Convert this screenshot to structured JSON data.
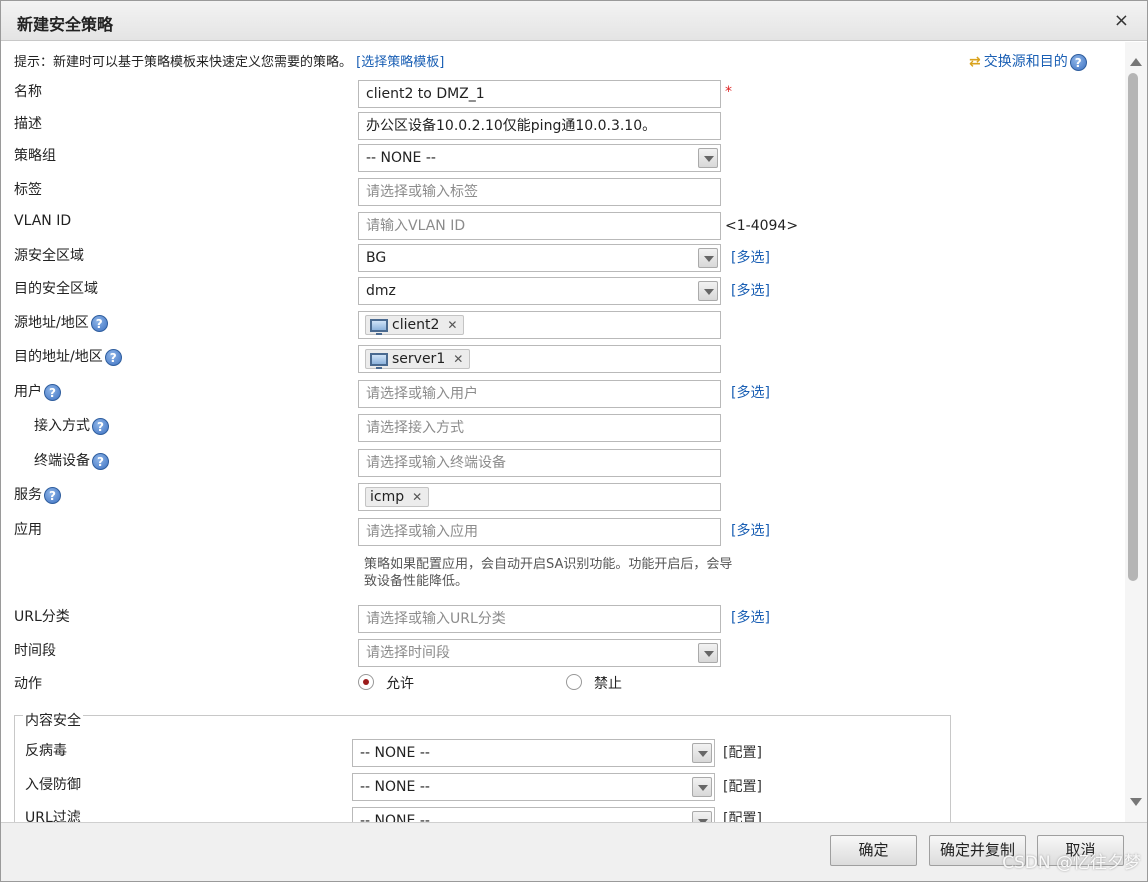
{
  "dialog": {
    "title": "新建安全策略",
    "close": "×"
  },
  "tip": {
    "text": "提示：新建时可以基于策略模板来快速定义您需要的策略。",
    "template_link": "[选择策略模板]"
  },
  "swap": {
    "label": "交换源和目的",
    "help": "?"
  },
  "form": {
    "name": {
      "label": "名称",
      "value": "client2 to DMZ_1",
      "required": "*"
    },
    "description": {
      "label": "描述",
      "value": "办公区设备10.0.2.10仅能ping通10.0.3.10。"
    },
    "policy_group": {
      "label": "策略组",
      "value": "-- NONE --"
    },
    "tag": {
      "label": "标签",
      "placeholder": "请选择或输入标签"
    },
    "vlan": {
      "label": "VLAN ID",
      "placeholder": "请输入VLAN ID",
      "range": "<1-4094>"
    },
    "src_zone": {
      "label": "源安全区域",
      "value": "BG",
      "multi": "[多选]"
    },
    "dst_zone": {
      "label": "目的安全区域",
      "value": "dmz",
      "multi": "[多选]"
    },
    "src_addr": {
      "label": "源地址/地区",
      "help": "?",
      "tag": "client2",
      "remove": "✕"
    },
    "dst_addr": {
      "label": "目的地址/地区",
      "help": "?",
      "tag": "server1",
      "remove": "✕"
    },
    "user": {
      "label": "用户",
      "help": "?",
      "placeholder": "请选择或输入用户",
      "multi": "[多选]"
    },
    "access": {
      "label": "接入方式",
      "help": "?",
      "placeholder": "请选择接入方式"
    },
    "terminal": {
      "label": "终端设备",
      "help": "?",
      "placeholder": "请选择或输入终端设备"
    },
    "service": {
      "label": "服务",
      "help": "?",
      "tag": "icmp",
      "remove": "✕"
    },
    "application": {
      "label": "应用",
      "placeholder": "请选择或输入应用",
      "multi": "[多选]",
      "note": "策略如果配置应用，会自动开启SA识别功能。功能开启后，会导致设备性能降低。"
    },
    "url_category": {
      "label": "URL分类",
      "placeholder": "请选择或输入URL分类",
      "multi": "[多选]"
    },
    "time_range": {
      "label": "时间段",
      "placeholder": "请选择时间段"
    },
    "action": {
      "label": "动作",
      "allow": "允许",
      "deny": "禁止",
      "selected": "allow"
    }
  },
  "content_security": {
    "legend": "内容安全",
    "antivirus": {
      "label": "反病毒",
      "value": "-- NONE --",
      "config": "[配置]"
    },
    "ips": {
      "label": "入侵防御",
      "value": "-- NONE --",
      "config": "[配置]"
    },
    "url_filter": {
      "label": "URL过滤",
      "value": "-- NONE --",
      "config": "[配置]"
    }
  },
  "footer": {
    "ok": "确定",
    "ok_copy": "确定并复制",
    "cancel": "取消"
  },
  "watermark": "CSDN @忆往夕梦"
}
